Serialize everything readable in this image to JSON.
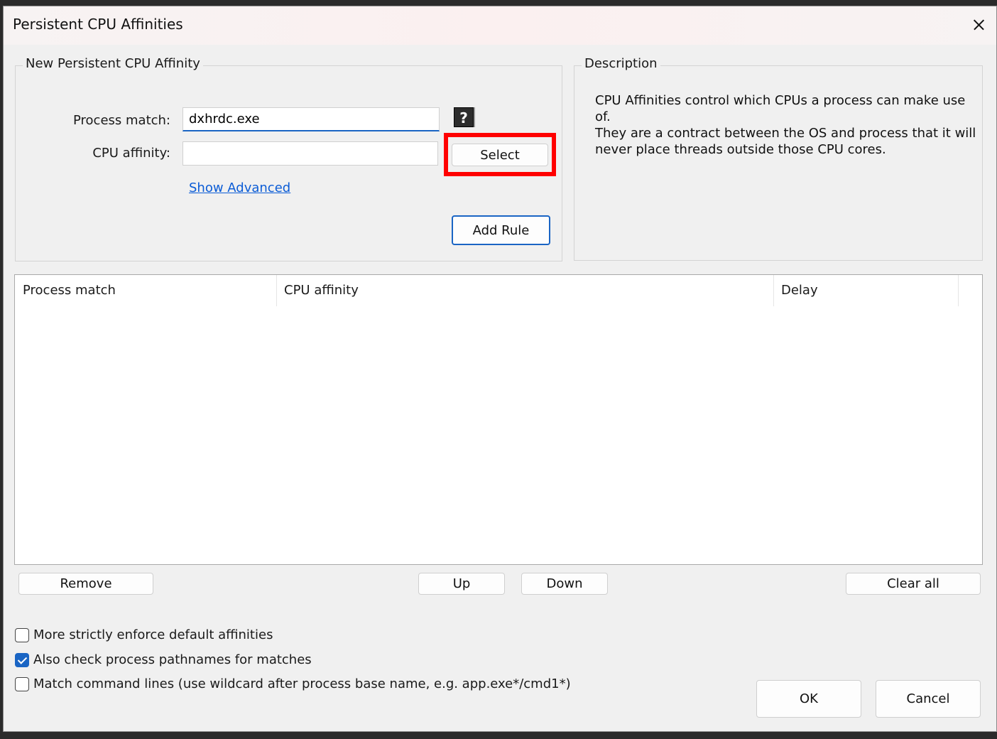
{
  "window": {
    "title": "Persistent CPU Affinities"
  },
  "new_rule": {
    "group_title": "New Persistent CPU Affinity",
    "process_match_label": "Process match:",
    "process_match_value": "dxhrdc.exe",
    "cpu_affinity_label": "CPU affinity:",
    "cpu_affinity_value": "",
    "help_icon_glyph": "?",
    "select_label": "Select",
    "show_advanced_label": "Show Advanced",
    "add_rule_label": "Add Rule"
  },
  "description": {
    "group_title": "Description",
    "lines": [
      "CPU Affinities control which CPUs a process can make use of.",
      "They are a contract between the OS and process that it will",
      "never place threads outside those CPU cores."
    ]
  },
  "table": {
    "columns": [
      "Process match",
      "CPU affinity",
      "Delay"
    ],
    "rows": []
  },
  "list_buttons": {
    "remove": "Remove",
    "up": "Up",
    "down": "Down",
    "clear_all": "Clear all"
  },
  "options": [
    {
      "label": "More strictly enforce default affinities",
      "checked": false
    },
    {
      "label": "Also check process pathnames for matches",
      "checked": true
    },
    {
      "label": "Match command lines (use wildcard after process base name, e.g. app.exe*/cmd1*)",
      "checked": false
    }
  ],
  "dialog_buttons": {
    "ok": "OK",
    "cancel": "Cancel"
  },
  "colors": {
    "accent": "#1a65c4",
    "highlight": "#ff0000",
    "link": "#0b5cd6"
  }
}
